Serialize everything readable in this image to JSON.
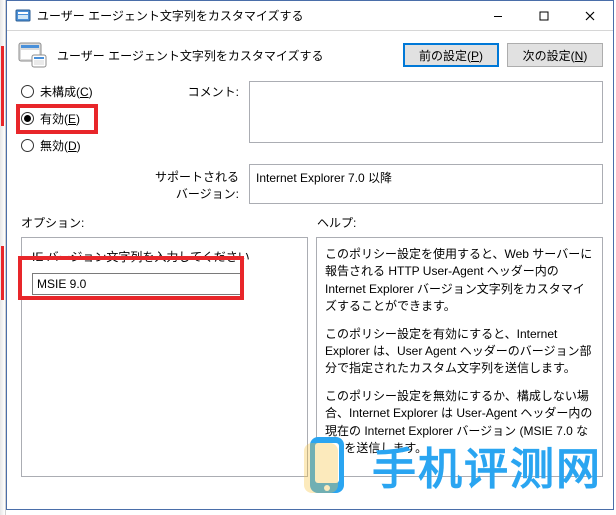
{
  "window": {
    "title": "ユーザー エージェント文字列をカスタマイズする"
  },
  "header": {
    "title": "ユーザー エージェント文字列をカスタマイズする",
    "prev_label": "前の設定(P)",
    "next_label": "次の設定(N)"
  },
  "radios": {
    "not_configured": "未構成(C)",
    "enabled": "有効(E)",
    "disabled": "無効(D)",
    "selected": "enabled"
  },
  "labels": {
    "comment": "コメント:",
    "supported": "サポートされるバージョン:",
    "options": "オプション:",
    "help": "ヘルプ:"
  },
  "fields": {
    "comment_value": "",
    "supported_value": "Internet Explorer 7.0 以降",
    "ie_version_prompt": "IE バージョン文字列を入力してください",
    "ie_version_value": "MSIE 9.0"
  },
  "help": {
    "p1": "このポリシー設定を使用すると、Web サーバーに報告される HTTP User-Agent ヘッダー内の Internet Explorer バージョン文字列をカスタマイズすることができます。",
    "p2": "このポリシー設定を有効にすると、Internet Explorer は、User Agent ヘッダーのバージョン部分で指定されたカスタム文字列を送信します。",
    "p3": "このポリシー設定を無効にするか、構成しない場合、Internet Explorer は User-Agent ヘッダー内の現在の Internet Explorer バージョン (MSIE 7.0 など) を送信します。"
  },
  "watermark": {
    "text": "手机评测网"
  },
  "icons": {
    "app": "app-icon",
    "minimize": "—",
    "maximize": "□",
    "close": "✕"
  }
}
